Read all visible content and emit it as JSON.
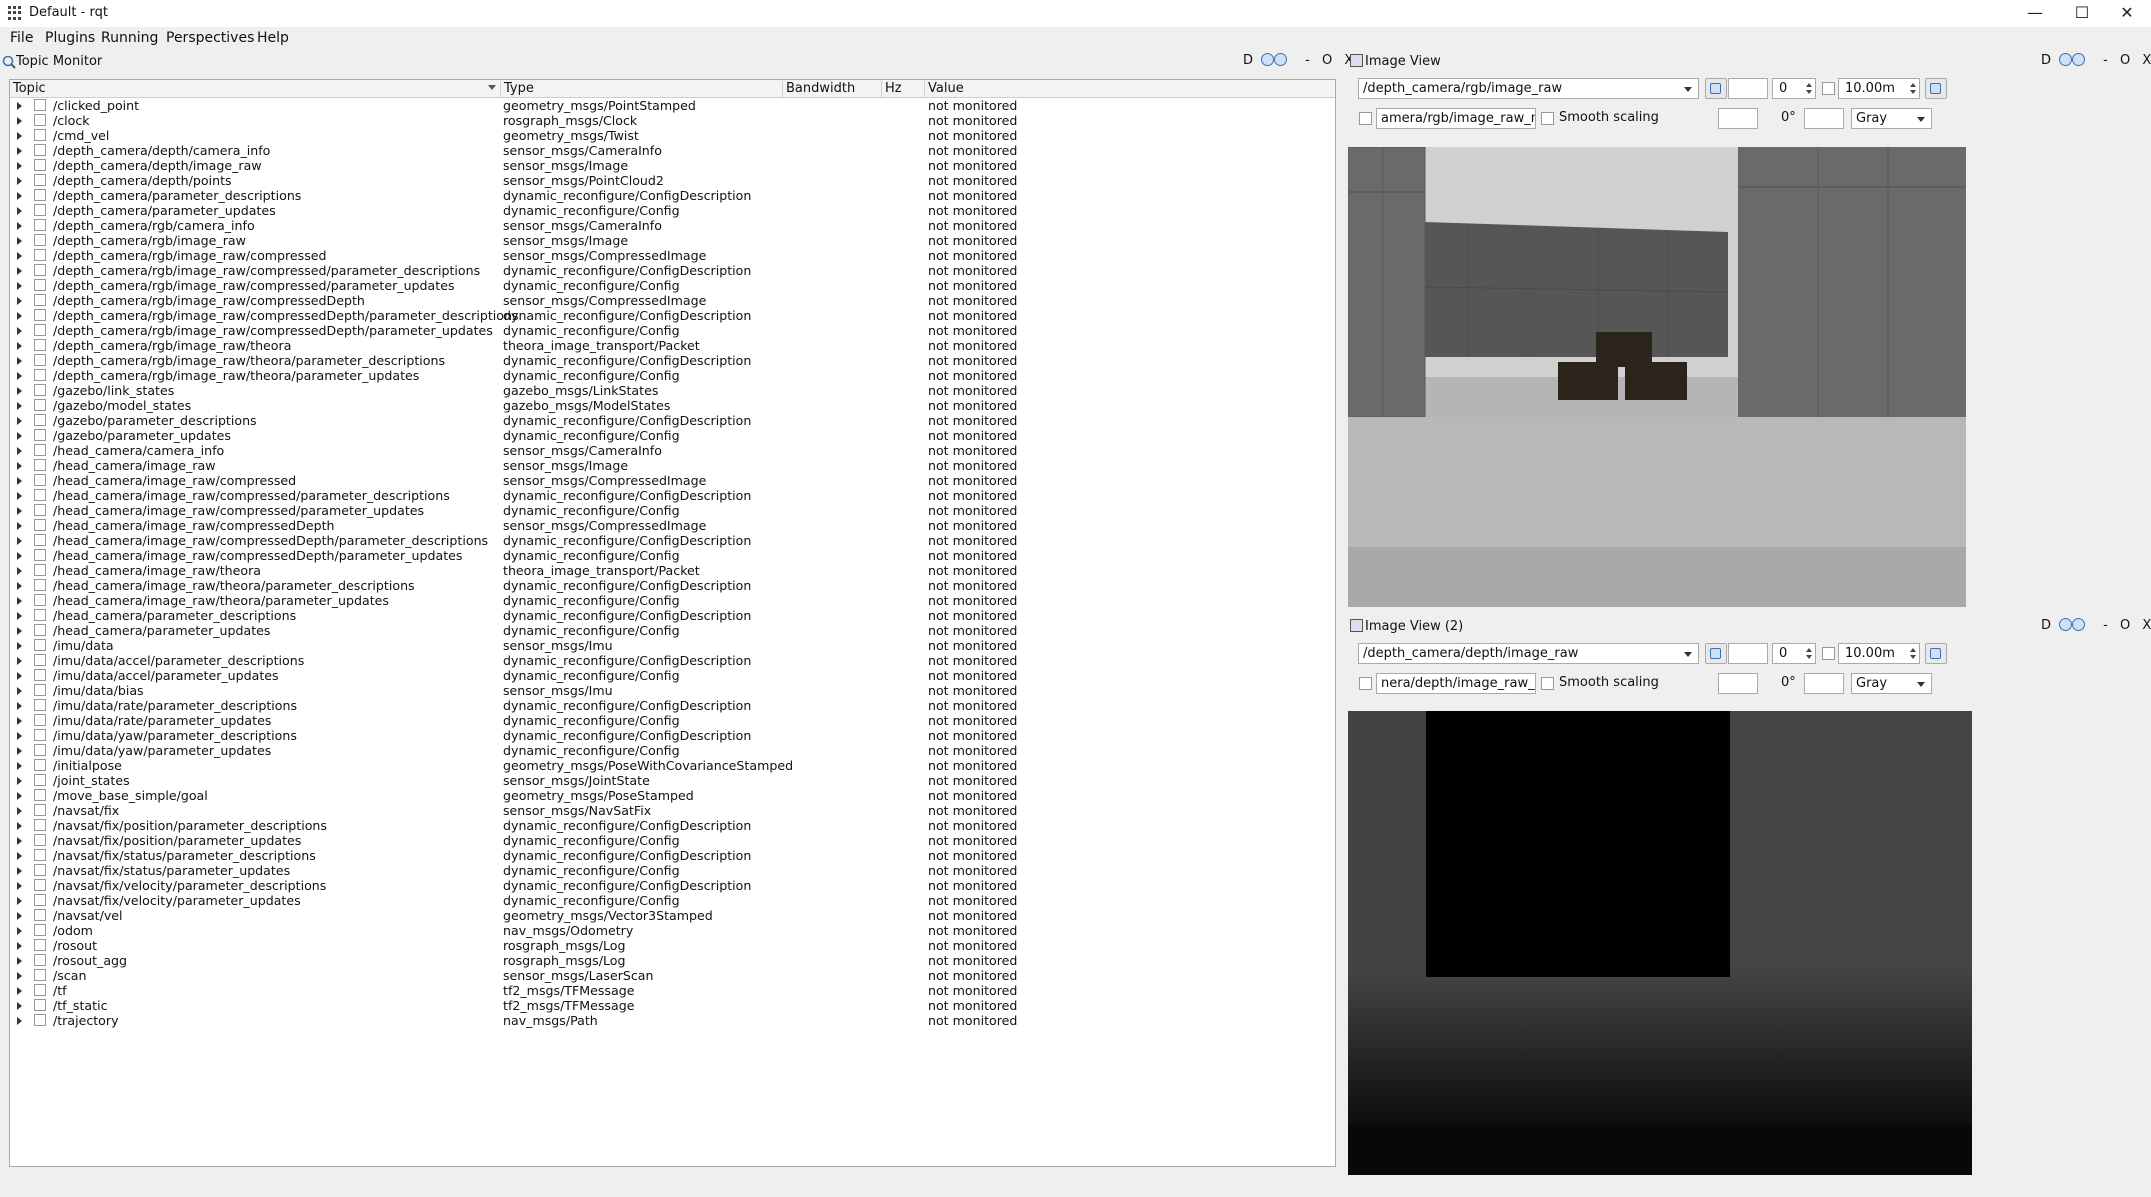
{
  "window": {
    "title": "Default - rqt",
    "minimize": "—",
    "maximize": "☐",
    "close": "✕"
  },
  "menu": [
    "File",
    "Plugins",
    "Running",
    "Perspectives",
    "Help"
  ],
  "topic_monitor": {
    "title": "Topic Monitor",
    "dock_controls": {
      "d": "D",
      "min": "-",
      "float": "O",
      "close": "X"
    },
    "columns": {
      "topic": "Topic",
      "type": "Type",
      "bandwidth": "Bandwidth",
      "hz": "Hz",
      "value": "Value"
    },
    "rows": [
      {
        "topic": "/clicked_point",
        "type": "geometry_msgs/PointStamped",
        "value": "not monitored"
      },
      {
        "topic": "/clock",
        "type": "rosgraph_msgs/Clock",
        "value": "not monitored"
      },
      {
        "topic": "/cmd_vel",
        "type": "geometry_msgs/Twist",
        "value": "not monitored"
      },
      {
        "topic": "/depth_camera/depth/camera_info",
        "type": "sensor_msgs/CameraInfo",
        "value": "not monitored"
      },
      {
        "topic": "/depth_camera/depth/image_raw",
        "type": "sensor_msgs/Image",
        "value": "not monitored"
      },
      {
        "topic": "/depth_camera/depth/points",
        "type": "sensor_msgs/PointCloud2",
        "value": "not monitored"
      },
      {
        "topic": "/depth_camera/parameter_descriptions",
        "type": "dynamic_reconfigure/ConfigDescription",
        "value": "not monitored"
      },
      {
        "topic": "/depth_camera/parameter_updates",
        "type": "dynamic_reconfigure/Config",
        "value": "not monitored"
      },
      {
        "topic": "/depth_camera/rgb/camera_info",
        "type": "sensor_msgs/CameraInfo",
        "value": "not monitored"
      },
      {
        "topic": "/depth_camera/rgb/image_raw",
        "type": "sensor_msgs/Image",
        "value": "not monitored"
      },
      {
        "topic": "/depth_camera/rgb/image_raw/compressed",
        "type": "sensor_msgs/CompressedImage",
        "value": "not monitored"
      },
      {
        "topic": "/depth_camera/rgb/image_raw/compressed/parameter_descriptions",
        "type": "dynamic_reconfigure/ConfigDescription",
        "value": "not monitored"
      },
      {
        "topic": "/depth_camera/rgb/image_raw/compressed/parameter_updates",
        "type": "dynamic_reconfigure/Config",
        "value": "not monitored"
      },
      {
        "topic": "/depth_camera/rgb/image_raw/compressedDepth",
        "type": "sensor_msgs/CompressedImage",
        "value": "not monitored"
      },
      {
        "topic": "/depth_camera/rgb/image_raw/compressedDepth/parameter_descriptions",
        "type": "dynamic_reconfigure/ConfigDescription",
        "value": "not monitored"
      },
      {
        "topic": "/depth_camera/rgb/image_raw/compressedDepth/parameter_updates",
        "type": "dynamic_reconfigure/Config",
        "value": "not monitored"
      },
      {
        "topic": "/depth_camera/rgb/image_raw/theora",
        "type": "theora_image_transport/Packet",
        "value": "not monitored"
      },
      {
        "topic": "/depth_camera/rgb/image_raw/theora/parameter_descriptions",
        "type": "dynamic_reconfigure/ConfigDescription",
        "value": "not monitored"
      },
      {
        "topic": "/depth_camera/rgb/image_raw/theora/parameter_updates",
        "type": "dynamic_reconfigure/Config",
        "value": "not monitored"
      },
      {
        "topic": "/gazebo/link_states",
        "type": "gazebo_msgs/LinkStates",
        "value": "not monitored"
      },
      {
        "topic": "/gazebo/model_states",
        "type": "gazebo_msgs/ModelStates",
        "value": "not monitored"
      },
      {
        "topic": "/gazebo/parameter_descriptions",
        "type": "dynamic_reconfigure/ConfigDescription",
        "value": "not monitored"
      },
      {
        "topic": "/gazebo/parameter_updates",
        "type": "dynamic_reconfigure/Config",
        "value": "not monitored"
      },
      {
        "topic": "/head_camera/camera_info",
        "type": "sensor_msgs/CameraInfo",
        "value": "not monitored"
      },
      {
        "topic": "/head_camera/image_raw",
        "type": "sensor_msgs/Image",
        "value": "not monitored"
      },
      {
        "topic": "/head_camera/image_raw/compressed",
        "type": "sensor_msgs/CompressedImage",
        "value": "not monitored"
      },
      {
        "topic": "/head_camera/image_raw/compressed/parameter_descriptions",
        "type": "dynamic_reconfigure/ConfigDescription",
        "value": "not monitored"
      },
      {
        "topic": "/head_camera/image_raw/compressed/parameter_updates",
        "type": "dynamic_reconfigure/Config",
        "value": "not monitored"
      },
      {
        "topic": "/head_camera/image_raw/compressedDepth",
        "type": "sensor_msgs/CompressedImage",
        "value": "not monitored"
      },
      {
        "topic": "/head_camera/image_raw/compressedDepth/parameter_descriptions",
        "type": "dynamic_reconfigure/ConfigDescription",
        "value": "not monitored"
      },
      {
        "topic": "/head_camera/image_raw/compressedDepth/parameter_updates",
        "type": "dynamic_reconfigure/Config",
        "value": "not monitored"
      },
      {
        "topic": "/head_camera/image_raw/theora",
        "type": "theora_image_transport/Packet",
        "value": "not monitored"
      },
      {
        "topic": "/head_camera/image_raw/theora/parameter_descriptions",
        "type": "dynamic_reconfigure/ConfigDescription",
        "value": "not monitored"
      },
      {
        "topic": "/head_camera/image_raw/theora/parameter_updates",
        "type": "dynamic_reconfigure/Config",
        "value": "not monitored"
      },
      {
        "topic": "/head_camera/parameter_descriptions",
        "type": "dynamic_reconfigure/ConfigDescription",
        "value": "not monitored"
      },
      {
        "topic": "/head_camera/parameter_updates",
        "type": "dynamic_reconfigure/Config",
        "value": "not monitored"
      },
      {
        "topic": "/imu/data",
        "type": "sensor_msgs/Imu",
        "value": "not monitored"
      },
      {
        "topic": "/imu/data/accel/parameter_descriptions",
        "type": "dynamic_reconfigure/ConfigDescription",
        "value": "not monitored"
      },
      {
        "topic": "/imu/data/accel/parameter_updates",
        "type": "dynamic_reconfigure/Config",
        "value": "not monitored"
      },
      {
        "topic": "/imu/data/bias",
        "type": "sensor_msgs/Imu",
        "value": "not monitored"
      },
      {
        "topic": "/imu/data/rate/parameter_descriptions",
        "type": "dynamic_reconfigure/ConfigDescription",
        "value": "not monitored"
      },
      {
        "topic": "/imu/data/rate/parameter_updates",
        "type": "dynamic_reconfigure/Config",
        "value": "not monitored"
      },
      {
        "topic": "/imu/data/yaw/parameter_descriptions",
        "type": "dynamic_reconfigure/ConfigDescription",
        "value": "not monitored"
      },
      {
        "topic": "/imu/data/yaw/parameter_updates",
        "type": "dynamic_reconfigure/Config",
        "value": "not monitored"
      },
      {
        "topic": "/initialpose",
        "type": "geometry_msgs/PoseWithCovarianceStamped",
        "value": "not monitored"
      },
      {
        "topic": "/joint_states",
        "type": "sensor_msgs/JointState",
        "value": "not monitored"
      },
      {
        "topic": "/move_base_simple/goal",
        "type": "geometry_msgs/PoseStamped",
        "value": "not monitored"
      },
      {
        "topic": "/navsat/fix",
        "type": "sensor_msgs/NavSatFix",
        "value": "not monitored"
      },
      {
        "topic": "/navsat/fix/position/parameter_descriptions",
        "type": "dynamic_reconfigure/ConfigDescription",
        "value": "not monitored"
      },
      {
        "topic": "/navsat/fix/position/parameter_updates",
        "type": "dynamic_reconfigure/Config",
        "value": "not monitored"
      },
      {
        "topic": "/navsat/fix/status/parameter_descriptions",
        "type": "dynamic_reconfigure/ConfigDescription",
        "value": "not monitored"
      },
      {
        "topic": "/navsat/fix/status/parameter_updates",
        "type": "dynamic_reconfigure/Config",
        "value": "not monitored"
      },
      {
        "topic": "/navsat/fix/velocity/parameter_descriptions",
        "type": "dynamic_reconfigure/ConfigDescription",
        "value": "not monitored"
      },
      {
        "topic": "/navsat/fix/velocity/parameter_updates",
        "type": "dynamic_reconfigure/Config",
        "value": "not monitored"
      },
      {
        "topic": "/navsat/vel",
        "type": "geometry_msgs/Vector3Stamped",
        "value": "not monitored"
      },
      {
        "topic": "/odom",
        "type": "nav_msgs/Odometry",
        "value": "not monitored"
      },
      {
        "topic": "/rosout",
        "type": "rosgraph_msgs/Log",
        "value": "not monitored"
      },
      {
        "topic": "/rosout_agg",
        "type": "rosgraph_msgs/Log",
        "value": "not monitored"
      },
      {
        "topic": "/scan",
        "type": "sensor_msgs/LaserScan",
        "value": "not monitored"
      },
      {
        "topic": "/tf",
        "type": "tf2_msgs/TFMessage",
        "value": "not monitored"
      },
      {
        "topic": "/tf_static",
        "type": "tf2_msgs/TFMessage",
        "value": "not monitored"
      },
      {
        "topic": "/trajectory",
        "type": "nav_msgs/Path",
        "value": "not monitored"
      }
    ]
  },
  "image_view_1": {
    "title": "Image View",
    "topic": "/depth_camera/rgb/image_raw",
    "min_value": "0",
    "max_value": "10.00m",
    "mouse_topic": "amera/rgb/image_raw_mouse_left",
    "smooth_label": "Smooth scaling",
    "rotation": "0°",
    "colormap": "Gray",
    "dock_controls": {
      "d": "D",
      "min": "-",
      "float": "O",
      "close": "X"
    }
  },
  "image_view_2": {
    "title": "Image View (2)",
    "topic": "/depth_camera/depth/image_raw",
    "min_value": "0",
    "max_value": "10.00m",
    "mouse_topic": "nera/depth/image_raw_mouse_left",
    "smooth_label": "Smooth scaling",
    "rotation": "0°",
    "colormap": "Gray",
    "dock_controls": {
      "d": "D",
      "min": "-",
      "float": "O",
      "close": "X"
    }
  }
}
